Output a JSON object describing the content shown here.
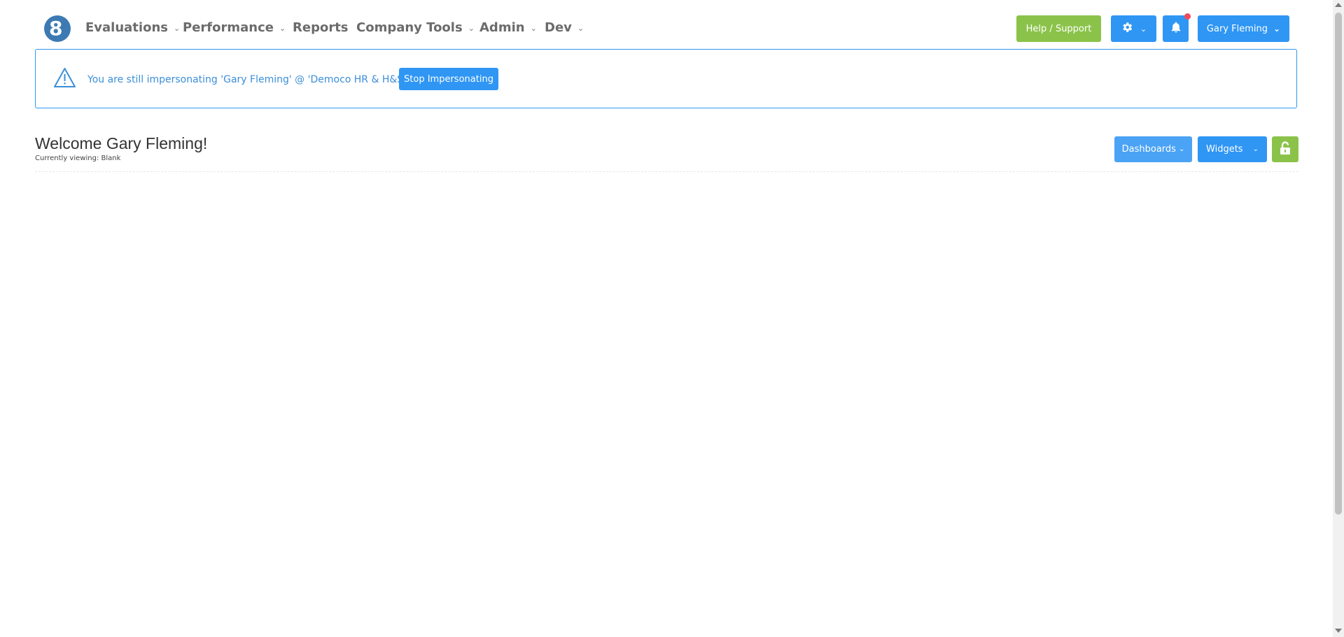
{
  "nav": {
    "items": [
      {
        "label": "Evaluations",
        "has_dropdown": true
      },
      {
        "label": "Performance",
        "has_dropdown": true
      },
      {
        "label": "Reports",
        "has_dropdown": false
      },
      {
        "label": "Company Tools",
        "has_dropdown": true
      },
      {
        "label": "Admin",
        "has_dropdown": true
      },
      {
        "label": "Dev",
        "has_dropdown": true
      }
    ],
    "help_label": "Help / Support",
    "user_label": "Gary Fleming"
  },
  "alert": {
    "message": "You are still impersonating 'Gary Fleming' @ 'Democo HR & H&S Ltd'",
    "stop_label": "Stop Impersonating"
  },
  "header": {
    "welcome": "Welcome Gary Fleming!",
    "viewing": "Currently viewing: Blank",
    "dashboards_label": "Dashboards",
    "widgets_label": "Widgets"
  },
  "colors": {
    "green": "#8bc34a",
    "blue": "#2f96f4",
    "notification": "#f44a5a"
  },
  "icons": {
    "gear": "gear-icon",
    "bell": "bell-icon",
    "warning": "warning-icon",
    "lock": "unlock-icon"
  }
}
